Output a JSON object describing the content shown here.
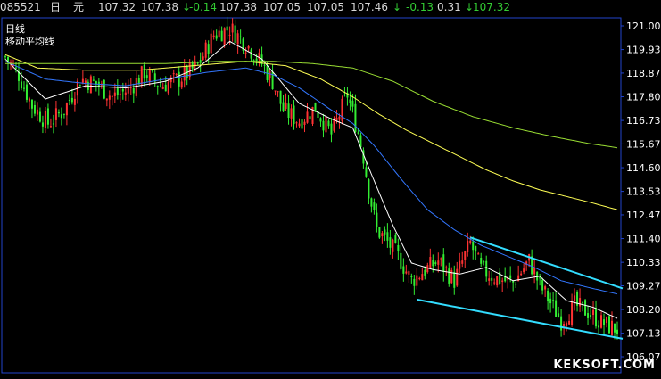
{
  "quote_bar": {
    "code": "085521",
    "period": "日",
    "unit": "元",
    "values": [
      "107.32",
      "107.38"
    ],
    "change": "-0.14",
    "v3": "107.38",
    "v4": "107.05",
    "v5": "107.05",
    "v6": "107.46",
    "change2": "-0.13",
    "v7": "0.31",
    "last": "107.32",
    "arrow": "↓"
  },
  "chart_labels": {
    "period_label": "日线",
    "indicator_label": "移动平均线"
  },
  "watermark": "KEKSOFT.COM",
  "colors": {
    "up_candle": "#ff3333",
    "down_candle": "#33ee33",
    "ma_fast": "#ffffff",
    "ma_mid": "#3377ff",
    "ma_yellow": "#ffff55",
    "ma_slow": "#99dd33",
    "trendline": "#33ddff",
    "frame": "#2244cc"
  },
  "chart_data": {
    "type": "candlestick",
    "y_ticks": [
      "121.00",
      "119.93",
      "118.87",
      "117.80",
      "116.73",
      "115.67",
      "114.60",
      "113.53",
      "112.47",
      "111.40",
      "110.33",
      "109.27",
      "108.20",
      "107.13",
      "106.07"
    ],
    "ylim": [
      106.07,
      121.0
    ],
    "candle_count": 230,
    "close_path": [
      [
        0,
        119.6
      ],
      [
        5,
        118.8
      ],
      [
        10,
        117.4
      ],
      [
        16,
        116.6
      ],
      [
        22,
        117.2
      ],
      [
        28,
        118.6
      ],
      [
        34,
        118.4
      ],
      [
        40,
        117.8
      ],
      [
        46,
        118.1
      ],
      [
        52,
        118.9
      ],
      [
        58,
        118.3
      ],
      [
        65,
        118.6
      ],
      [
        72,
        119.2
      ],
      [
        78,
        120.6
      ],
      [
        84,
        120.9
      ],
      [
        90,
        120.2
      ],
      [
        96,
        119.3
      ],
      [
        100,
        118.5
      ],
      [
        104,
        117.2
      ],
      [
        110,
        116.7
      ],
      [
        116,
        117.3
      ],
      [
        122,
        116.1
      ],
      [
        128,
        117.9
      ],
      [
        132,
        116.2
      ],
      [
        134,
        115.1
      ],
      [
        136,
        113.6
      ],
      [
        139,
        111.8
      ],
      [
        142,
        111.4
      ],
      [
        147,
        110.6
      ],
      [
        152,
        109.5
      ],
      [
        156,
        109.9
      ],
      [
        162,
        110.4
      ],
      [
        168,
        109.5
      ],
      [
        174,
        111.2
      ],
      [
        178,
        110.0
      ],
      [
        184,
        109.6
      ],
      [
        190,
        109.4
      ],
      [
        196,
        110.4
      ],
      [
        200,
        109.3
      ],
      [
        204,
        108.5
      ],
      [
        208,
        107.7
      ],
      [
        213,
        108.4
      ],
      [
        218,
        108.1
      ],
      [
        223,
        107.6
      ],
      [
        229,
        107.3
      ]
    ],
    "moving_averages": [
      {
        "color_key": "ma_fast",
        "path": [
          [
            0,
            119.5
          ],
          [
            15,
            117.7
          ],
          [
            30,
            118.3
          ],
          [
            45,
            118.2
          ],
          [
            60,
            118.5
          ],
          [
            72,
            119.1
          ],
          [
            84,
            120.3
          ],
          [
            96,
            119.5
          ],
          [
            110,
            117.5
          ],
          [
            122,
            116.8
          ],
          [
            130,
            116.4
          ],
          [
            137,
            114.3
          ],
          [
            145,
            112.0
          ],
          [
            152,
            110.3
          ],
          [
            160,
            110.0
          ],
          [
            170,
            109.8
          ],
          [
            180,
            110.1
          ],
          [
            190,
            109.5
          ],
          [
            200,
            109.7
          ],
          [
            210,
            108.6
          ],
          [
            220,
            108.3
          ],
          [
            229,
            107.8
          ]
        ]
      },
      {
        "color_key": "ma_mid",
        "path": [
          [
            0,
            119.4
          ],
          [
            15,
            118.6
          ],
          [
            30,
            118.4
          ],
          [
            45,
            118.3
          ],
          [
            60,
            118.6
          ],
          [
            75,
            118.9
          ],
          [
            90,
            119.1
          ],
          [
            100,
            118.8
          ],
          [
            110,
            118.2
          ],
          [
            122,
            117.2
          ],
          [
            130,
            116.6
          ],
          [
            138,
            115.6
          ],
          [
            148,
            114.1
          ],
          [
            158,
            112.7
          ],
          [
            168,
            111.8
          ],
          [
            178,
            111.1
          ],
          [
            188,
            110.6
          ],
          [
            198,
            110.1
          ],
          [
            208,
            109.5
          ],
          [
            218,
            109.2
          ],
          [
            229,
            108.9
          ]
        ]
      },
      {
        "color_key": "ma_yellow",
        "path": [
          [
            0,
            119.7
          ],
          [
            12,
            119.1
          ],
          [
            30,
            119.0
          ],
          [
            50,
            119.0
          ],
          [
            70,
            119.2
          ],
          [
            90,
            119.4
          ],
          [
            105,
            119.2
          ],
          [
            118,
            118.6
          ],
          [
            130,
            117.8
          ],
          [
            140,
            117.0
          ],
          [
            150,
            116.3
          ],
          [
            160,
            115.7
          ],
          [
            170,
            115.1
          ],
          [
            180,
            114.5
          ],
          [
            190,
            114.0
          ],
          [
            200,
            113.6
          ],
          [
            210,
            113.3
          ],
          [
            220,
            113.0
          ],
          [
            229,
            112.7
          ]
        ]
      },
      {
        "color_key": "ma_slow",
        "path": [
          [
            0,
            119.3
          ],
          [
            20,
            119.3
          ],
          [
            40,
            119.3
          ],
          [
            60,
            119.3
          ],
          [
            80,
            119.4
          ],
          [
            100,
            119.4
          ],
          [
            115,
            119.3
          ],
          [
            130,
            119.1
          ],
          [
            145,
            118.5
          ],
          [
            160,
            117.6
          ],
          [
            175,
            116.9
          ],
          [
            190,
            116.4
          ],
          [
            205,
            116.0
          ],
          [
            218,
            115.7
          ],
          [
            229,
            115.5
          ]
        ]
      }
    ],
    "trendlines": [
      {
        "from": [
          174,
          111.45
        ],
        "to": [
          230,
          109.15
        ]
      },
      {
        "from": [
          154,
          108.65
        ],
        "to": [
          230,
          106.88
        ]
      }
    ]
  }
}
